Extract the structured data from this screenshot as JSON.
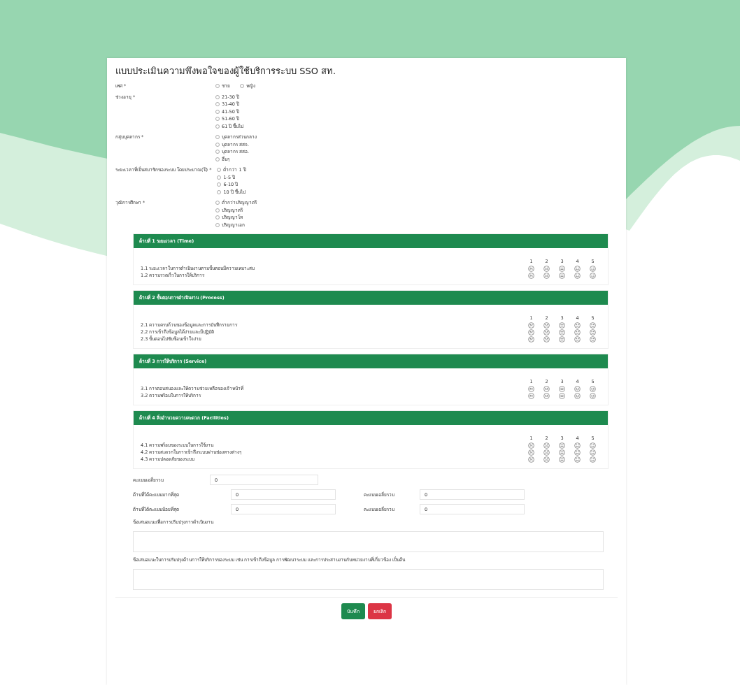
{
  "title": "แบบประเมินความพึงพอใจของผู้ใช้บริการระบบ SSO สท.",
  "questions": [
    {
      "label": "เพศ *",
      "kind": "inline",
      "options": [
        {
          "label": "ชาย",
          "selected": false
        },
        {
          "label": "หญิง",
          "selected": false
        }
      ]
    },
    {
      "label": "ช่วงอายุ *",
      "kind": "stack",
      "options": [
        {
          "label": "21-30 ปี",
          "selected": false
        },
        {
          "label": "31-40 ปี",
          "selected": false
        },
        {
          "label": "41-50 ปี",
          "selected": false
        },
        {
          "label": "51-60 ปี",
          "selected": false
        },
        {
          "label": "61 ปี ขึ้นไป",
          "selected": false
        }
      ]
    },
    {
      "label": "กลุ่มบุคลากร *",
      "kind": "stack",
      "options": [
        {
          "label": "บุคลากรส่วนกลาง",
          "selected": false
        },
        {
          "label": "บุคลากร สสจ.",
          "selected": false
        },
        {
          "label": "บุคลากร สสอ.",
          "selected": false
        },
        {
          "label": "อื่นๆ",
          "selected": false
        }
      ]
    },
    {
      "label": "ระยะเวลาที่เป็นสมาชิกของระบบ โดยประมาณ(ปี) *",
      "kind": "stack",
      "options": [
        {
          "label": "ต่ำกว่า 1 ปี",
          "selected": false
        },
        {
          "label": "1-5 ปี",
          "selected": false
        },
        {
          "label": "6-10 ปี",
          "selected": false
        },
        {
          "label": "10 ปี ขึ้นไป",
          "selected": false
        }
      ]
    },
    {
      "label": "วุฒิการศึกษา *",
      "kind": "stack",
      "options": [
        {
          "label": "ต่ำกว่าปริญญาตรี",
          "selected": false
        },
        {
          "label": "ปริญญาตรี",
          "selected": false
        },
        {
          "label": "ปริญญาโท",
          "selected": false
        },
        {
          "label": "ปริญญาเอก",
          "selected": false
        }
      ]
    }
  ],
  "sections": [
    {
      "title": "ด้านที่ 1 ระยะเวลา (Time)",
      "scale": [
        "1",
        "2",
        "3",
        "4",
        "5"
      ],
      "items": [
        {
          "text": "1.1 ระยะเวลาในการดำเนินงานตามขั้นตอนมีความเหมาะสม",
          "options": [
            {
              "selected": false
            },
            {
              "selected": false
            },
            {
              "selected": false
            },
            {
              "selected": false
            },
            {
              "selected": false
            }
          ]
        },
        {
          "text": "1.2 ความรวดเร็วในการให้บริการ",
          "options": [
            {
              "selected": false
            },
            {
              "selected": false
            },
            {
              "selected": false
            },
            {
              "selected": false
            },
            {
              "selected": false
            }
          ]
        }
      ]
    },
    {
      "title": "ด้านที่ 2 ขั้นตอนการดำเนินงาน (Process)",
      "scale": [
        "1",
        "2",
        "3",
        "4",
        "5"
      ],
      "items": [
        {
          "text": "2.1 ความครบถ้วนของข้อมูลและการบันทึกรายการ",
          "options": [
            {
              "selected": false
            },
            {
              "selected": false
            },
            {
              "selected": false
            },
            {
              "selected": false
            },
            {
              "selected": false
            }
          ]
        },
        {
          "text": "2.2 การเข้าถึงข้อมูลได้ง่ายและมีปฏิบัติ",
          "options": [
            {
              "selected": false
            },
            {
              "selected": false
            },
            {
              "selected": false
            },
            {
              "selected": false
            },
            {
              "selected": false
            }
          ]
        },
        {
          "text": "2.3 ขั้นตอนไม่ซับซ้อนเข้าใจง่าย",
          "options": [
            {
              "selected": false
            },
            {
              "selected": false
            },
            {
              "selected": false
            },
            {
              "selected": false
            },
            {
              "selected": false
            }
          ]
        }
      ]
    },
    {
      "title": "ด้านที่ 3 การให้บริการ (Service)",
      "scale": [
        "1",
        "2",
        "3",
        "4",
        "5"
      ],
      "items": [
        {
          "text": "3.1 การตอบสนองและให้ความช่วยเหลือของเจ้าหน้าที่",
          "options": [
            {
              "selected": false
            },
            {
              "selected": false
            },
            {
              "selected": false
            },
            {
              "selected": false
            },
            {
              "selected": false
            }
          ]
        },
        {
          "text": "3.2 ความพร้อมในการให้บริการ",
          "options": [
            {
              "selected": false
            },
            {
              "selected": false
            },
            {
              "selected": false
            },
            {
              "selected": false
            },
            {
              "selected": false
            }
          ]
        }
      ]
    },
    {
      "title": "ด้านที่ 4 สิ่งอำนวยความสะดวก (Facilities)",
      "scale": [
        "1",
        "2",
        "3",
        "4",
        "5"
      ],
      "items": [
        {
          "text": "4.1 ความพร้อมของระบบในการใช้งาน",
          "options": [
            {
              "selected": false
            },
            {
              "selected": false
            },
            {
              "selected": false
            },
            {
              "selected": false
            },
            {
              "selected": false
            }
          ]
        },
        {
          "text": "4.2 ความสะดวกในการเข้าถึงระบบผ่านช่องทางต่างๆ",
          "options": [
            {
              "selected": false
            },
            {
              "selected": false
            },
            {
              "selected": false
            },
            {
              "selected": false
            },
            {
              "selected": false
            }
          ]
        },
        {
          "text": "4.3 ความปลอดภัยของระบบ",
          "options": [
            {
              "selected": false
            },
            {
              "selected": false
            },
            {
              "selected": false
            },
            {
              "selected": false
            },
            {
              "selected": false
            }
          ]
        }
      ]
    }
  ],
  "summary": {
    "average": {
      "label": "คะแนนเฉลี่ยรวม",
      "value": "0"
    },
    "rows": [
      {
        "label": "ด้านที่ได้คะแนนมากที่สุด",
        "value": "0",
        "score_label": "คะแนนเฉลี่ยรวม",
        "score_value": "0"
      },
      {
        "label": "ด้านที่ได้คะแนนน้อยที่สุด",
        "value": "0",
        "score_label": "คะแนนเฉลี่ยรวม",
        "score_value": "0"
      }
    ]
  },
  "comments": [
    {
      "label": "ข้อเสนอแนะเพื่อการปรับปรุงการดำเนินงาน"
    },
    {
      "label": "ข้อเสนอแนะในการปรับปรุงด้านการให้บริการของระบบ เช่น การเข้าถึงข้อมูล การพัฒนาระบบ และการประสานงานกับหน่วยงานที่เกี่ยวข้อง เป็นต้น"
    }
  ],
  "buttons": [
    {
      "label": "บันทึก",
      "kind": "primary"
    },
    {
      "label": "ยกเลิก",
      "kind": "danger"
    }
  ]
}
